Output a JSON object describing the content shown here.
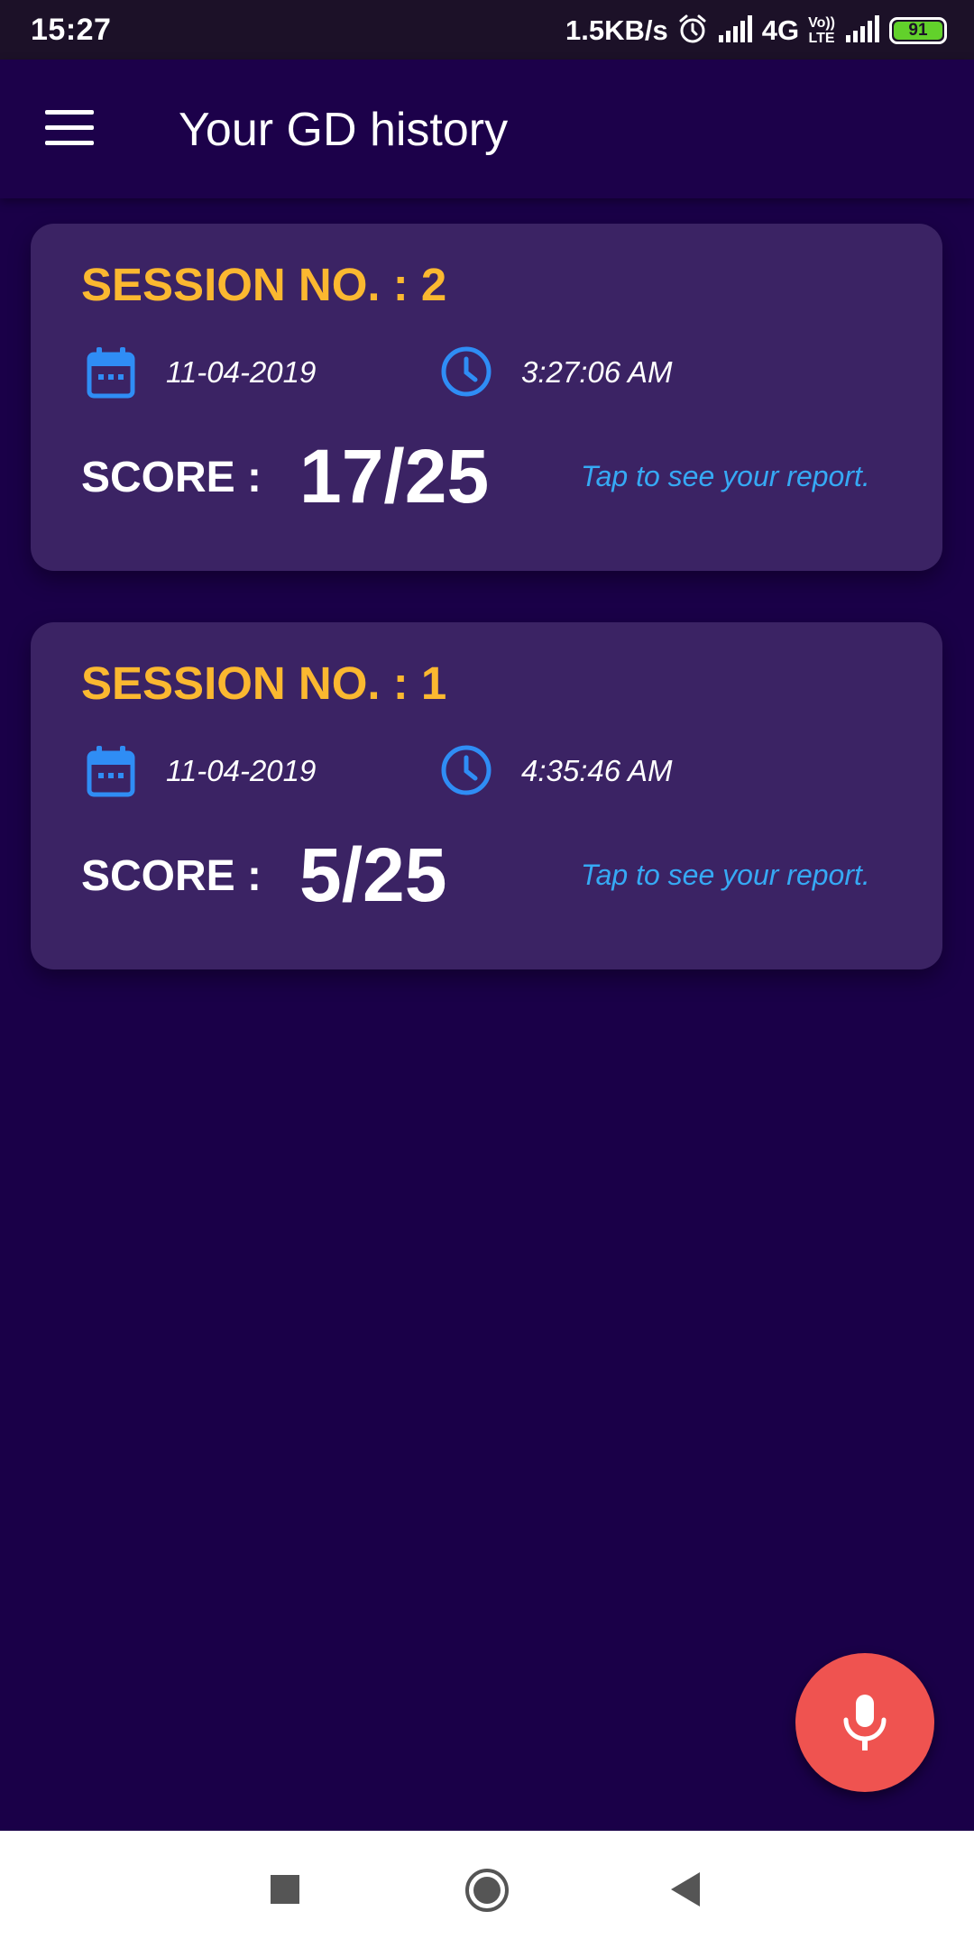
{
  "status_bar": {
    "time": "15:27",
    "speed": "1.5KB/s",
    "network": "4G",
    "volte_top": "Vo))",
    "volte_bottom": "LTE",
    "battery": "91"
  },
  "app_bar": {
    "title": "Your GD history",
    "menu_icon": "hamburger-menu-icon"
  },
  "sessions": [
    {
      "label": "SESSION NO. : 2",
      "date": "11-04-2019",
      "time": "3:27:06 AM",
      "score_label": "SCORE :",
      "score": "17/25",
      "report_link": "Tap to see your report."
    },
    {
      "label": "SESSION NO. : 1",
      "date": "11-04-2019",
      "time": "4:35:46 AM",
      "score_label": "SCORE :",
      "score": "5/25",
      "report_link": "Tap to see your report."
    }
  ],
  "fab": {
    "icon": "microphone-icon",
    "color": "#ef5350"
  },
  "colors": {
    "background": "#1a0048",
    "card": "#3b2364",
    "accent": "#fbb830",
    "link": "#36a9f4",
    "icon_blue": "#2f8df5"
  }
}
